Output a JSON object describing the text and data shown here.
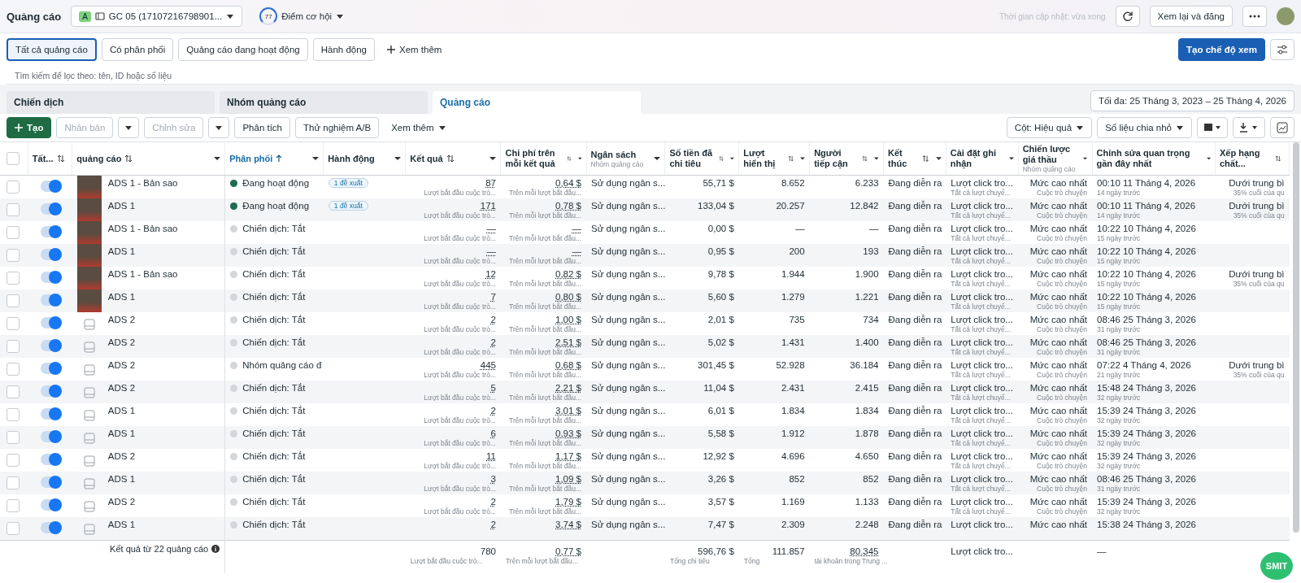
{
  "topbar": {
    "title": "Quảng cáo",
    "account_badge": "A",
    "account": "GC 05 (17107216798901...",
    "score": "77",
    "score_label": "Điểm cơ hội",
    "updated": "Thời gian cập nhật: vừa xong",
    "review": "Xem lại và đăng"
  },
  "filters": [
    {
      "label": "Tất cả quảng cáo",
      "selected": true
    },
    {
      "label": "Có phân phối",
      "selected": false
    },
    {
      "label": "Quảng cáo đang hoạt động",
      "selected": false
    },
    {
      "label": "Hành động",
      "selected": false
    }
  ],
  "filters_more": "Xem thêm",
  "create_view": "Tạo chế độ xem",
  "search": {
    "placeholder": "Tìm kiếm để lọc theo: tên, ID hoặc số liệu"
  },
  "tabs": [
    {
      "label": "Chiến dịch",
      "selected": false
    },
    {
      "label": "Nhóm quảng cáo",
      "selected": false
    },
    {
      "label": "Quảng cáo",
      "selected": true
    }
  ],
  "date_range": "Tối đa: 25 Tháng 3, 2023 – 25 Tháng 4, 2026",
  "toolbar": {
    "create": "Tạo",
    "duplicate": {
      "label": "Nhân bản",
      "disabled": true
    },
    "edit": {
      "label": "Chỉnh sửa",
      "disabled": true
    },
    "analyze": "Phân tích",
    "ab_test": "Thử nghiệm A/B",
    "more": "Xem thêm",
    "columns": "Cột: Hiệu quả",
    "breakdown": "Số liệu chia nhỏ"
  },
  "table": {
    "select_all": {
      "checked": false
    },
    "columns": [
      {
        "label": "Tất...",
        "sortable": true,
        "sorted": false,
        "menu": false
      },
      {
        "label": "quảng cáo",
        "sortable": true,
        "sorted": false,
        "menu": true
      },
      {
        "label": "Phân phối",
        "sortable": true,
        "sorted": true,
        "menu": true
      },
      {
        "label": "Hành động",
        "sortable": false,
        "sorted": false,
        "menu": true
      },
      {
        "label": "Kết quả",
        "sortable": true,
        "sorted": false,
        "menu": true
      },
      {
        "label": "Chi phí trên mỗi kết quả",
        "sortable": true,
        "sorted": false,
        "menu": true
      },
      {
        "label": "Ngân sách",
        "sub": "Nhóm quảng cáo",
        "sortable": false,
        "sorted": false,
        "menu": true
      },
      {
        "label": "Số tiền đã chi tiêu",
        "sortable": true,
        "sorted": false,
        "menu": true
      },
      {
        "label": "Lượt hiển thị",
        "sortable": true,
        "sorted": false,
        "menu": true
      },
      {
        "label": "Người tiếp cận",
        "sortable": true,
        "sorted": false,
        "menu": true
      },
      {
        "label": "Kết thúc",
        "sortable": true,
        "sorted": false,
        "menu": true
      },
      {
        "label": "Cài đặt ghi nhận",
        "sortable": false,
        "sorted": false,
        "menu": true
      },
      {
        "label": "Chiến lược giá thầu",
        "sub": "Nhóm quảng cáo",
        "sortable": false,
        "sorted": false,
        "menu": true
      },
      {
        "label": "Chỉnh sửa quan trọng gần đây nhất",
        "sortable": false,
        "sorted": false,
        "menu": true
      },
      {
        "label": "Xếp hạng chất...",
        "sortable": true,
        "sorted": false,
        "menu": false
      }
    ],
    "rows": [
      {
        "checked": false,
        "on": true,
        "kind": "photo",
        "name": "ADS 1 - Bản sao",
        "delivery": "Đang hoạt động",
        "color": "#1e6b4f",
        "action": "1 đề xuất",
        "result": "87",
        "result_note": "Lượt bắt đầu cuộc trò...",
        "cost": "0,64 $",
        "cost_note": "Trên mỗi lượt bắt đầu...",
        "budget": "Sử dụng ngân s...",
        "spent": "55,71 $",
        "impressions": "8.652",
        "reach": "6.233",
        "end": "Đang diễn ra",
        "attribution": "Lượt click tro...",
        "attribution_note": "Tất cả lượt chuyể...",
        "bid": "Mức cao nhất",
        "bid_note": "Cuộc trò chuyện",
        "edited": "00:10 11 Tháng 4, 2026",
        "edited_note": "14 ngày trước",
        "quality": "Dưới trung bì",
        "quality_note": "35% cuối của qu"
      },
      {
        "checked": false,
        "on": true,
        "kind": "photo",
        "name": "ADS 1",
        "delivery": "Đang hoạt động",
        "color": "#1e6b4f",
        "action": "1 đề xuất",
        "result": "171",
        "result_note": "Lượt bắt đầu cuộc trò...",
        "cost": "0,78 $",
        "cost_note": "Trên mỗi lượt bắt đầu...",
        "budget": "Sử dụng ngân s...",
        "spent": "133,04 $",
        "impressions": "20.257",
        "reach": "12.842",
        "end": "Đang diễn ra",
        "attribution": "Lượt click tro...",
        "attribution_note": "Tất cả lượt chuyể...",
        "bid": "Mức cao nhất",
        "bid_note": "Cuộc trò chuyện",
        "edited": "00:10 11 Tháng 4, 2026",
        "edited_note": "14 ngày trước",
        "quality": "Dưới trung bì",
        "quality_note": "35% cuối của qu"
      },
      {
        "checked": false,
        "on": true,
        "kind": "photo",
        "name": "ADS 1 - Bản sao",
        "delivery": "Chiến dịch: Tắt",
        "color": "#d3d6db",
        "result": "—",
        "result_note": "Lượt bắt đầu cuộc trò...",
        "cost": "—",
        "cost_note": "Trên mỗi lượt bắt đầu...",
        "budget": "Sử dụng ngân s...",
        "spent": "0,00 $",
        "impressions": "—",
        "reach": "—",
        "end": "Đang diễn ra",
        "attribution": "Lượt click tro...",
        "attribution_note": "Tất cả lượt chuyể...",
        "bid": "Mức cao nhất",
        "bid_note": "Cuộc trò chuyện",
        "edited": "10:22 10 Tháng 4, 2026",
        "edited_note": "15 ngày trước"
      },
      {
        "checked": false,
        "on": true,
        "kind": "photo",
        "name": "ADS 1",
        "delivery": "Chiến dịch: Tắt",
        "color": "#d3d6db",
        "result": "—",
        "result_note": "Lượt bắt đầu cuộc trò...",
        "cost": "—",
        "cost_note": "Trên mỗi lượt bắt đầu...",
        "budget": "Sử dụng ngân s...",
        "spent": "0,95 $",
        "impressions": "200",
        "reach": "193",
        "end": "Đang diễn ra",
        "attribution": "Lượt click tro...",
        "attribution_note": "Tất cả lượt chuyể...",
        "bid": "Mức cao nhất",
        "bid_note": "Cuộc trò chuyện",
        "edited": "10:22 10 Tháng 4, 2026",
        "edited_note": "15 ngày trước"
      },
      {
        "checked": false,
        "on": true,
        "kind": "photo",
        "name": "ADS 1 - Bản sao",
        "delivery": "Chiến dịch: Tắt",
        "color": "#d3d6db",
        "result": "12",
        "result_note": "Lượt bắt đầu cuộc trò...",
        "cost": "0,82 $",
        "cost_note": "Trên mỗi lượt bắt đầu...",
        "budget": "Sử dụng ngân s...",
        "spent": "9,78 $",
        "impressions": "1.944",
        "reach": "1.900",
        "end": "Đang diễn ra",
        "attribution": "Lượt click tro...",
        "attribution_note": "Tất cả lượt chuyể...",
        "bid": "Mức cao nhất",
        "bid_note": "Cuộc trò chuyện",
        "edited": "10:22 10 Tháng 4, 2026",
        "edited_note": "15 ngày trước",
        "quality": "Dưới trung bì",
        "quality_note": "35% cuối của qu"
      },
      {
        "checked": false,
        "on": true,
        "kind": "photo",
        "name": "ADS 1",
        "delivery": "Chiến dịch: Tắt",
        "color": "#d3d6db",
        "result": "7",
        "result_note": "Lượt bắt đầu cuộc trò...",
        "cost": "0,80 $",
        "cost_note": "Trên mỗi lượt bắt đầu...",
        "budget": "Sử dụng ngân s...",
        "spent": "5,60 $",
        "impressions": "1.279",
        "reach": "1.221",
        "end": "Đang diễn ra",
        "attribution": "Lượt click tro...",
        "attribution_note": "Tất cả lượt chuyể...",
        "bid": "Mức cao nhất",
        "bid_note": "Cuộc trò chuyện",
        "edited": "10:22 10 Tháng 4, 2026",
        "edited_note": "15 ngày trước"
      },
      {
        "checked": false,
        "on": true,
        "kind": "icon",
        "name": "ADS 2",
        "delivery": "Chiến dịch: Tắt",
        "color": "#d3d6db",
        "result": "2",
        "result_note": "Lượt bắt đầu cuộc trò...",
        "cost": "1,00 $",
        "cost_note": "Trên mỗi lượt bắt đầu...",
        "budget": "Sử dụng ngân s...",
        "spent": "2,01 $",
        "impressions": "735",
        "reach": "734",
        "end": "Đang diễn ra",
        "attribution": "Lượt click tro...",
        "attribution_note": "Tất cả lượt chuyể...",
        "bid": "Mức cao nhất",
        "bid_note": "Cuộc trò chuyện",
        "edited": "08:46 25 Tháng 3, 2026",
        "edited_note": "31 ngày trước"
      },
      {
        "checked": false,
        "on": true,
        "kind": "icon",
        "name": "ADS 2",
        "delivery": "Chiến dịch: Tắt",
        "color": "#d3d6db",
        "result": "2",
        "result_note": "Lượt bắt đầu cuộc trò...",
        "cost": "2,51 $",
        "cost_note": "Trên mỗi lượt bắt đầu...",
        "budget": "Sử dụng ngân s...",
        "spent": "5,02 $",
        "impressions": "1.431",
        "reach": "1.400",
        "end": "Đang diễn ra",
        "attribution": "Lượt click tro...",
        "attribution_note": "Tất cả lượt chuyể...",
        "bid": "Mức cao nhất",
        "bid_note": "Cuộc trò chuyện",
        "edited": "08:46 25 Tháng 3, 2026",
        "edited_note": "31 ngày trước"
      },
      {
        "checked": false,
        "on": true,
        "kind": "icon",
        "name": "ADS 2",
        "delivery": "Nhóm quảng cáo đ",
        "color": "#d3d6db",
        "result": "445",
        "result_note": "Lượt bắt đầu cuộc trò...",
        "cost": "0,68 $",
        "cost_note": "Trên mỗi lượt bắt đầu...",
        "budget": "Sử dụng ngân s...",
        "spent": "301,45 $",
        "impressions": "52.928",
        "reach": "36.184",
        "end": "Đang diễn ra",
        "attribution": "Lượt click tro...",
        "attribution_note": "Tất cả lượt chuyể...",
        "bid": "Mức cao nhất",
        "bid_note": "Cuộc trò chuyện",
        "edited": "07:22 4 Tháng 4, 2026",
        "edited_note": "21 ngày trước",
        "quality": "Dưới trung bì",
        "quality_note": "35% cuối của qu"
      },
      {
        "checked": false,
        "on": true,
        "kind": "icon",
        "name": "ADS 2",
        "delivery": "Chiến dịch: Tắt",
        "color": "#d3d6db",
        "result": "5",
        "result_note": "Lượt bắt đầu cuộc trò...",
        "cost": "2,21 $",
        "cost_note": "Trên mỗi lượt bắt đầu...",
        "budget": "Sử dụng ngân s...",
        "spent": "11,04 $",
        "impressions": "2.431",
        "reach": "2.415",
        "end": "Đang diễn ra",
        "attribution": "Lượt click tro...",
        "attribution_note": "Tất cả lượt chuyể...",
        "bid": "Mức cao nhất",
        "bid_note": "Cuộc trò chuyện",
        "edited": "15:48 24 Tháng 3, 2026",
        "edited_note": "32 ngày trước"
      },
      {
        "checked": false,
        "on": true,
        "kind": "icon",
        "name": "ADS 1",
        "delivery": "Chiến dịch: Tắt",
        "color": "#d3d6db",
        "result": "2",
        "result_note": "Lượt bắt đầu cuộc trò...",
        "cost": "3,01 $",
        "cost_note": "Trên mỗi lượt bắt đầu...",
        "budget": "Sử dụng ngân s...",
        "spent": "6,01 $",
        "impressions": "1.834",
        "reach": "1.834",
        "end": "Đang diễn ra",
        "attribution": "Lượt click tro...",
        "attribution_note": "Tất cả lượt chuyể...",
        "bid": "Mức cao nhất",
        "bid_note": "Cuộc trò chuyện",
        "edited": "15:39 24 Tháng 3, 2026",
        "edited_note": "32 ngày trước"
      },
      {
        "checked": false,
        "on": true,
        "kind": "icon",
        "name": "ADS 1",
        "delivery": "Chiến dịch: Tắt",
        "color": "#d3d6db",
        "result": "6",
        "result_note": "Lượt bắt đầu cuộc trò...",
        "cost": "0,93 $",
        "cost_note": "Trên mỗi lượt bắt đầu...",
        "budget": "Sử dụng ngân s...",
        "spent": "5,58 $",
        "impressions": "1.912",
        "reach": "1.878",
        "end": "Đang diễn ra",
        "attribution": "Lượt click tro...",
        "attribution_note": "Tất cả lượt chuyể...",
        "bid": "Mức cao nhất",
        "bid_note": "Cuộc trò chuyện",
        "edited": "15:39 24 Tháng 3, 2026",
        "edited_note": "32 ngày trước"
      },
      {
        "checked": false,
        "on": true,
        "kind": "icon",
        "name": "ADS 2",
        "delivery": "Chiến dịch: Tắt",
        "color": "#d3d6db",
        "result": "11",
        "result_note": "Lượt bắt đầu cuộc trò...",
        "cost": "1,17 $",
        "cost_note": "Trên mỗi lượt bắt đầu...",
        "budget": "Sử dụng ngân s...",
        "spent": "12,92 $",
        "impressions": "4.696",
        "reach": "4.650",
        "end": "Đang diễn ra",
        "attribution": "Lượt click tro...",
        "attribution_note": "Tất cả lượt chuyể...",
        "bid": "Mức cao nhất",
        "bid_note": "Cuộc trò chuyện",
        "edited": "15:39 24 Tháng 3, 2026",
        "edited_note": "32 ngày trước"
      },
      {
        "checked": false,
        "on": true,
        "kind": "icon",
        "name": "ADS 1",
        "delivery": "Chiến dịch: Tắt",
        "color": "#d3d6db",
        "result": "3",
        "result_note": "Lượt bắt đầu cuộc trò...",
        "cost": "1,09 $",
        "cost_note": "Trên mỗi lượt bắt đầu...",
        "budget": "Sử dụng ngân s...",
        "spent": "3,26 $",
        "impressions": "852",
        "reach": "852",
        "end": "Đang diễn ra",
        "attribution": "Lượt click tro...",
        "attribution_note": "Tất cả lượt chuyể...",
        "bid": "Mức cao nhất",
        "bid_note": "Cuộc trò chuyện",
        "edited": "08:46 25 Tháng 3, 2026",
        "edited_note": "31 ngày trước"
      },
      {
        "checked": false,
        "on": true,
        "kind": "icon",
        "name": "ADS 2",
        "delivery": "Chiến dịch: Tắt",
        "color": "#d3d6db",
        "result": "2",
        "result_note": "Lượt bắt đầu cuộc trò...",
        "cost": "1,79 $",
        "cost_note": "Trên mỗi lượt bắt đầu...",
        "budget": "Sử dụng ngân s...",
        "spent": "3,57 $",
        "impressions": "1.169",
        "reach": "1.133",
        "end": "Đang diễn ra",
        "attribution": "Lượt click tro...",
        "attribution_note": "Tất cả lượt chuyể...",
        "bid": "Mức cao nhất",
        "bid_note": "Cuộc trò chuyện",
        "edited": "15:39 24 Tháng 3, 2026",
        "edited_note": "32 ngày trước"
      },
      {
        "checked": false,
        "on": true,
        "kind": "icon",
        "name": "ADS 1",
        "delivery": "Chiến dịch: Tắt",
        "color": "#d3d6db",
        "result": "2",
        "cost": "3,74 $",
        "budget": "Sử dụng ngân s...",
        "spent": "7,47 $",
        "impressions": "2.309",
        "reach": "2.248",
        "end": "Đang diễn ra",
        "attribution": "Lượt click tro...",
        "bid": "Mức cao nhất",
        "edited": "15:38 24 Tháng 3, 2026"
      }
    ],
    "footer": {
      "label": "Kết quả từ 22 quảng cáo",
      "result": "780",
      "result_note": "Lượt bắt đầu cuộc trò...",
      "cost": "0,77 $",
      "cost_note": "Trên mỗi lượt bắt đầu...",
      "spent": "596,76 $",
      "spent_note": "Tổng chi tiêu",
      "impressions": "111.857",
      "impressions_note": "Tổng",
      "reach": "80.345",
      "reach_note": "tài khoản trong Trung ...",
      "attribution": "Lượt click tro...",
      "edited": "—"
    }
  },
  "assistant_badge": "SMIT"
}
